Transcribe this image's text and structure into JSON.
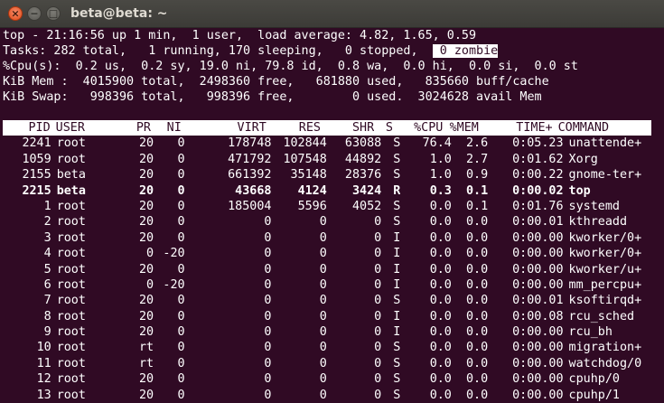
{
  "window": {
    "title": "beta@beta: ~"
  },
  "summary": {
    "line1": "top - 21:16:56 up 1 min,  1 user,  load average: 4.82, 1.65, 0.59",
    "line2_pre": "Tasks: 282 total,   1 running, 170 sleeping,   0 stopped,  ",
    "line2_zombie": " 0 zombie",
    "line3": "%Cpu(s):  0.2 us,  0.2 sy, 19.0 ni, 79.8 id,  0.8 wa,  0.0 hi,  0.0 si,  0.0 st",
    "line4": "KiB Mem :  4015900 total,  2498360 free,   681880 used,   835660 buff/cache",
    "line5": "KiB Swap:   998396 total,   998396 free,        0 used.  3024628 avail Mem"
  },
  "columns": [
    "PID",
    "USER",
    "PR",
    "NI",
    "VIRT",
    "RES",
    "SHR",
    "S",
    "%CPU",
    "%MEM",
    "TIME+",
    "COMMAND"
  ],
  "processes": [
    {
      "pid": "2241",
      "user": "root",
      "pr": "20",
      "ni": "0",
      "virt": "178748",
      "res": "102844",
      "shr": "63088",
      "s": "S",
      "cpu": "76.4",
      "mem": "2.6",
      "time": "0:05.23",
      "cmd": "unattende+",
      "bold": false
    },
    {
      "pid": "1059",
      "user": "root",
      "pr": "20",
      "ni": "0",
      "virt": "471792",
      "res": "107548",
      "shr": "44892",
      "s": "S",
      "cpu": "1.0",
      "mem": "2.7",
      "time": "0:01.62",
      "cmd": "Xorg",
      "bold": false
    },
    {
      "pid": "2155",
      "user": "beta",
      "pr": "20",
      "ni": "0",
      "virt": "661392",
      "res": "35148",
      "shr": "28376",
      "s": "S",
      "cpu": "1.0",
      "mem": "0.9",
      "time": "0:00.22",
      "cmd": "gnome-ter+",
      "bold": false
    },
    {
      "pid": "2215",
      "user": "beta",
      "pr": "20",
      "ni": "0",
      "virt": "43668",
      "res": "4124",
      "shr": "3424",
      "s": "R",
      "cpu": "0.3",
      "mem": "0.1",
      "time": "0:00.02",
      "cmd": "top",
      "bold": true
    },
    {
      "pid": "1",
      "user": "root",
      "pr": "20",
      "ni": "0",
      "virt": "185004",
      "res": "5596",
      "shr": "4052",
      "s": "S",
      "cpu": "0.0",
      "mem": "0.1",
      "time": "0:01.76",
      "cmd": "systemd",
      "bold": false
    },
    {
      "pid": "2",
      "user": "root",
      "pr": "20",
      "ni": "0",
      "virt": "0",
      "res": "0",
      "shr": "0",
      "s": "S",
      "cpu": "0.0",
      "mem": "0.0",
      "time": "0:00.01",
      "cmd": "kthreadd",
      "bold": false
    },
    {
      "pid": "3",
      "user": "root",
      "pr": "20",
      "ni": "0",
      "virt": "0",
      "res": "0",
      "shr": "0",
      "s": "I",
      "cpu": "0.0",
      "mem": "0.0",
      "time": "0:00.00",
      "cmd": "kworker/0+",
      "bold": false
    },
    {
      "pid": "4",
      "user": "root",
      "pr": "0",
      "ni": "-20",
      "virt": "0",
      "res": "0",
      "shr": "0",
      "s": "I",
      "cpu": "0.0",
      "mem": "0.0",
      "time": "0:00.00",
      "cmd": "kworker/0+",
      "bold": false
    },
    {
      "pid": "5",
      "user": "root",
      "pr": "20",
      "ni": "0",
      "virt": "0",
      "res": "0",
      "shr": "0",
      "s": "I",
      "cpu": "0.0",
      "mem": "0.0",
      "time": "0:00.00",
      "cmd": "kworker/u+",
      "bold": false
    },
    {
      "pid": "6",
      "user": "root",
      "pr": "0",
      "ni": "-20",
      "virt": "0",
      "res": "0",
      "shr": "0",
      "s": "I",
      "cpu": "0.0",
      "mem": "0.0",
      "time": "0:00.00",
      "cmd": "mm_percpu+",
      "bold": false
    },
    {
      "pid": "7",
      "user": "root",
      "pr": "20",
      "ni": "0",
      "virt": "0",
      "res": "0",
      "shr": "0",
      "s": "S",
      "cpu": "0.0",
      "mem": "0.0",
      "time": "0:00.01",
      "cmd": "ksoftirqd+",
      "bold": false
    },
    {
      "pid": "8",
      "user": "root",
      "pr": "20",
      "ni": "0",
      "virt": "0",
      "res": "0",
      "shr": "0",
      "s": "I",
      "cpu": "0.0",
      "mem": "0.0",
      "time": "0:00.08",
      "cmd": "rcu_sched",
      "bold": false
    },
    {
      "pid": "9",
      "user": "root",
      "pr": "20",
      "ni": "0",
      "virt": "0",
      "res": "0",
      "shr": "0",
      "s": "I",
      "cpu": "0.0",
      "mem": "0.0",
      "time": "0:00.00",
      "cmd": "rcu_bh",
      "bold": false
    },
    {
      "pid": "10",
      "user": "root",
      "pr": "rt",
      "ni": "0",
      "virt": "0",
      "res": "0",
      "shr": "0",
      "s": "S",
      "cpu": "0.0",
      "mem": "0.0",
      "time": "0:00.00",
      "cmd": "migration+",
      "bold": false
    },
    {
      "pid": "11",
      "user": "root",
      "pr": "rt",
      "ni": "0",
      "virt": "0",
      "res": "0",
      "shr": "0",
      "s": "S",
      "cpu": "0.0",
      "mem": "0.0",
      "time": "0:00.00",
      "cmd": "watchdog/0",
      "bold": false
    },
    {
      "pid": "12",
      "user": "root",
      "pr": "20",
      "ni": "0",
      "virt": "0",
      "res": "0",
      "shr": "0",
      "s": "S",
      "cpu": "0.0",
      "mem": "0.0",
      "time": "0:00.00",
      "cmd": "cpuhp/0",
      "bold": false
    },
    {
      "pid": "13",
      "user": "root",
      "pr": "20",
      "ni": "0",
      "virt": "0",
      "res": "0",
      "shr": "0",
      "s": "S",
      "cpu": "0.0",
      "mem": "0.0",
      "time": "0:00.00",
      "cmd": "cpuhp/1",
      "bold": false
    }
  ],
  "colors": {
    "terminal_bg": "#300a24",
    "terminal_fg": "#ffffff",
    "close_button": "#df4b16",
    "titlebar": "#3c3b37"
  },
  "icons": {
    "close": "close-icon",
    "minimize": "minimize-icon",
    "maximize": "maximize-icon"
  }
}
